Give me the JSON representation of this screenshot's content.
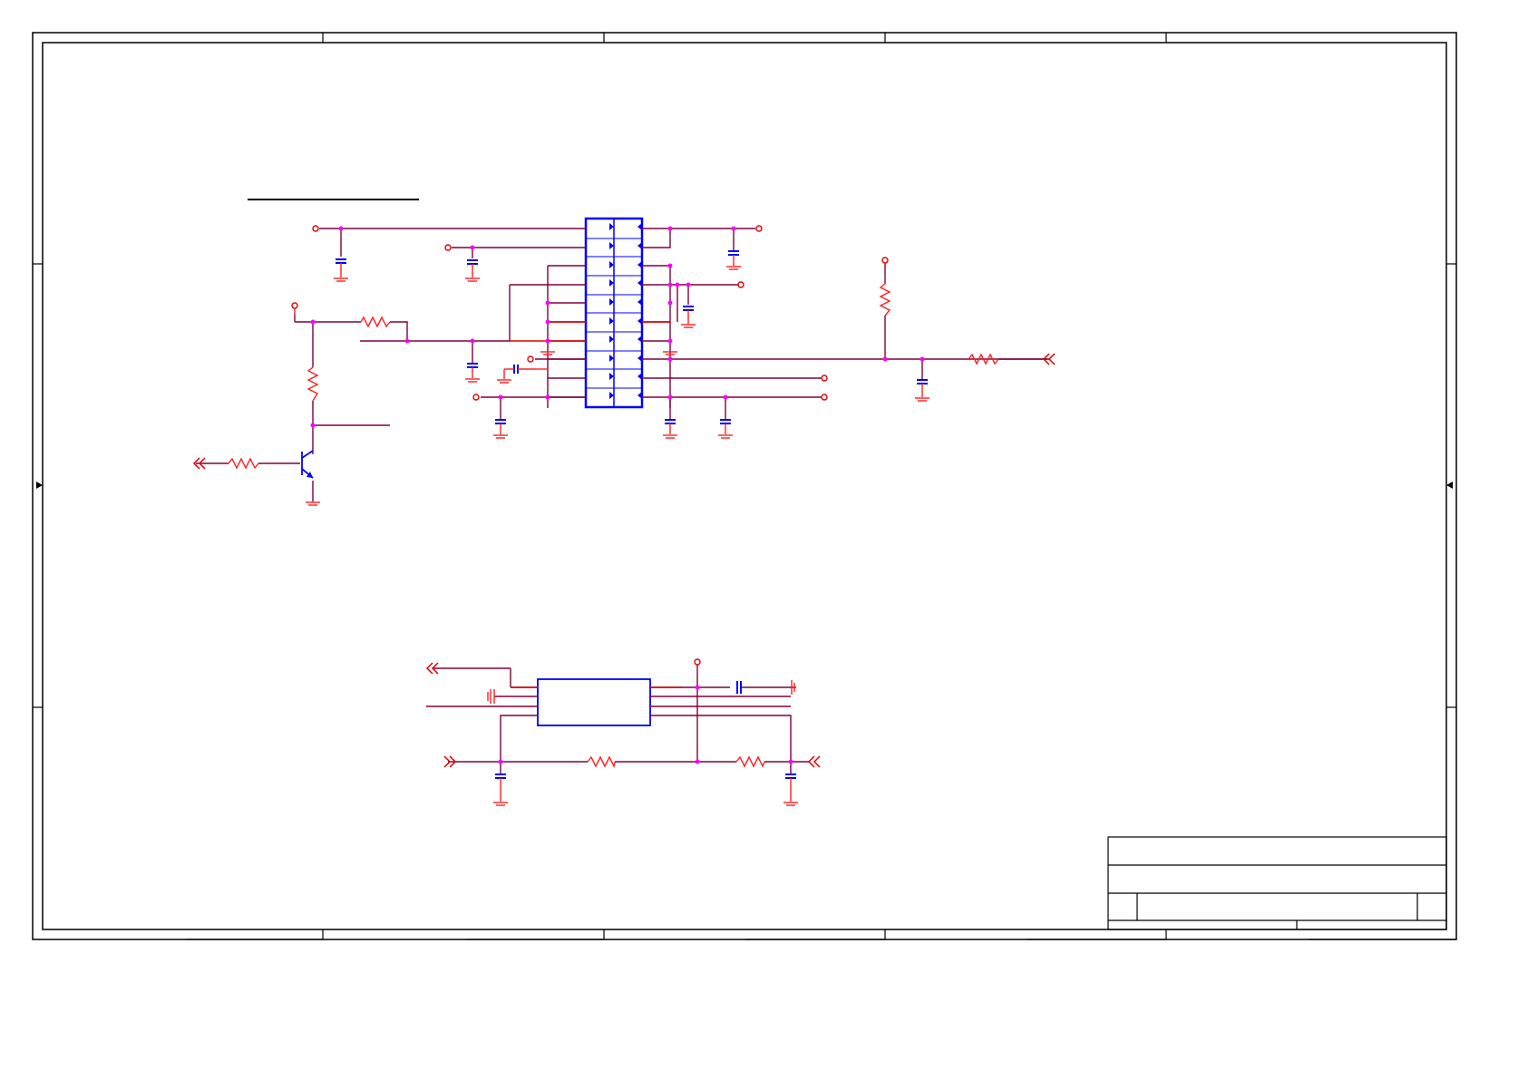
{
  "document": {
    "kind": "schematic-sheet",
    "visible_text": [],
    "title_block": {
      "title": "",
      "sheet": "",
      "revision": ""
    }
  },
  "colors": {
    "border": "#000000",
    "wire": "#800040",
    "power_net": "#e00000",
    "component": "#0000ff",
    "junction": "#ff00ff",
    "ic_outline": "#0000ff"
  },
  "symbols": {
    "upper_connector": "dual-row-header-icon",
    "lower_ic": "ic-block-icon",
    "transistor": "npn-transistor-icon",
    "resistor": "resistor-icon",
    "capacitor": "capacitor-icon",
    "ground": "ground-icon",
    "port": "offpage-connector-icon",
    "power": "power-terminal-icon"
  }
}
